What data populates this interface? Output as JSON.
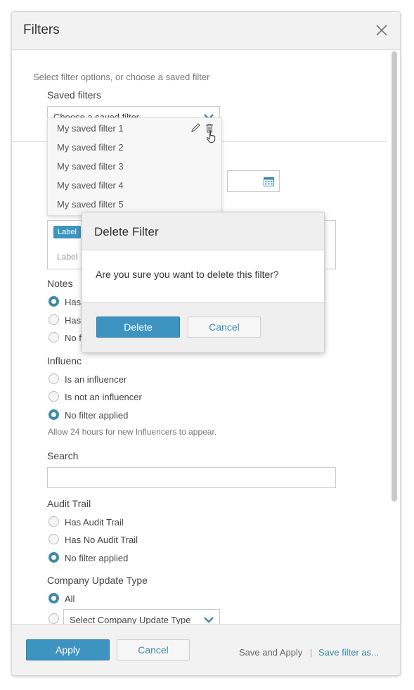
{
  "panel": {
    "title": "Filters"
  },
  "intro_hint": "Select filter options, or choose a saved filter",
  "saved_filters": {
    "label": "Saved filters",
    "placeholder": "Choose a saved filter",
    "items": [
      "My saved filter 1",
      "My saved filter 2",
      "My saved filter 3",
      "My saved filter 4",
      "My saved filter 5"
    ]
  },
  "labels_field": {
    "tag": "Label",
    "placeholder": "Label"
  },
  "notes": {
    "label": "Notes",
    "options": [
      "Has",
      "Has",
      "No fi"
    ]
  },
  "influencer": {
    "label": "Influenc",
    "options": [
      "Is an influencer",
      "Is not an influencer",
      "No filter applied"
    ],
    "hint": "Allow 24 hours for new Influencers to appear."
  },
  "search": {
    "label": "Search",
    "value": ""
  },
  "audit_trail": {
    "label": "Audit Trail",
    "options": [
      "Has Audit Trail",
      "Has No Audit Trail",
      "No filter applied"
    ]
  },
  "company_update": {
    "label": "Company Update Type",
    "option_all": "All",
    "select_placeholder": "Select Company Update Type"
  },
  "modal": {
    "title": "Delete Filter",
    "message": "Are you sure you want to delete this filter?",
    "delete_label": "Delete",
    "cancel_label": "Cancel"
  },
  "footer": {
    "apply_label": "Apply",
    "cancel_label": "Cancel",
    "save_apply_label": "Save and Apply",
    "separator": "|",
    "save_as_label": "Save filter as..."
  },
  "colors": {
    "accent": "#3e94c1",
    "link": "#3e89ad",
    "header_bg": "#f2f2f2"
  }
}
